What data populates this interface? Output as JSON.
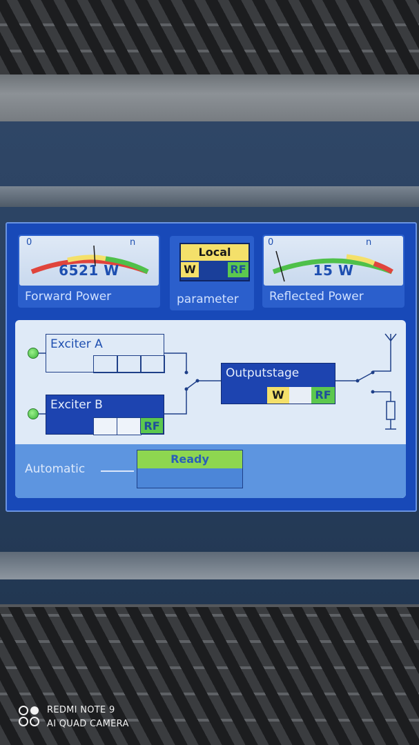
{
  "forward_meter": {
    "scale_min": "0",
    "scale_max": "n",
    "value": "6521 W",
    "label": "Forward Power"
  },
  "parameter": {
    "mode": "Local",
    "w_tag": "W",
    "rf_tag": "RF",
    "label": "parameter"
  },
  "reflected_meter": {
    "scale_min": "0",
    "scale_max": "n",
    "value": "15 W",
    "label": "Reflected Power"
  },
  "exciter_a": {
    "name": "Exciter A"
  },
  "exciter_b": {
    "name": "Exciter B",
    "rf_tag": "RF"
  },
  "outputstage": {
    "name": "Outputstage",
    "w_tag": "W",
    "rf_tag": "RF"
  },
  "status": {
    "mode_label": "Automatic",
    "state": "Ready"
  },
  "colors": {
    "screen_bg": "#1849b8",
    "status_ok": "#8ed650",
    "warn_yellow": "#f4e06a",
    "alarm_red": "#e0443c",
    "rf_green": "#5cc84e"
  },
  "camera_watermark": {
    "line1": "REDMI NOTE 9",
    "line2": "AI QUAD CAMERA"
  }
}
